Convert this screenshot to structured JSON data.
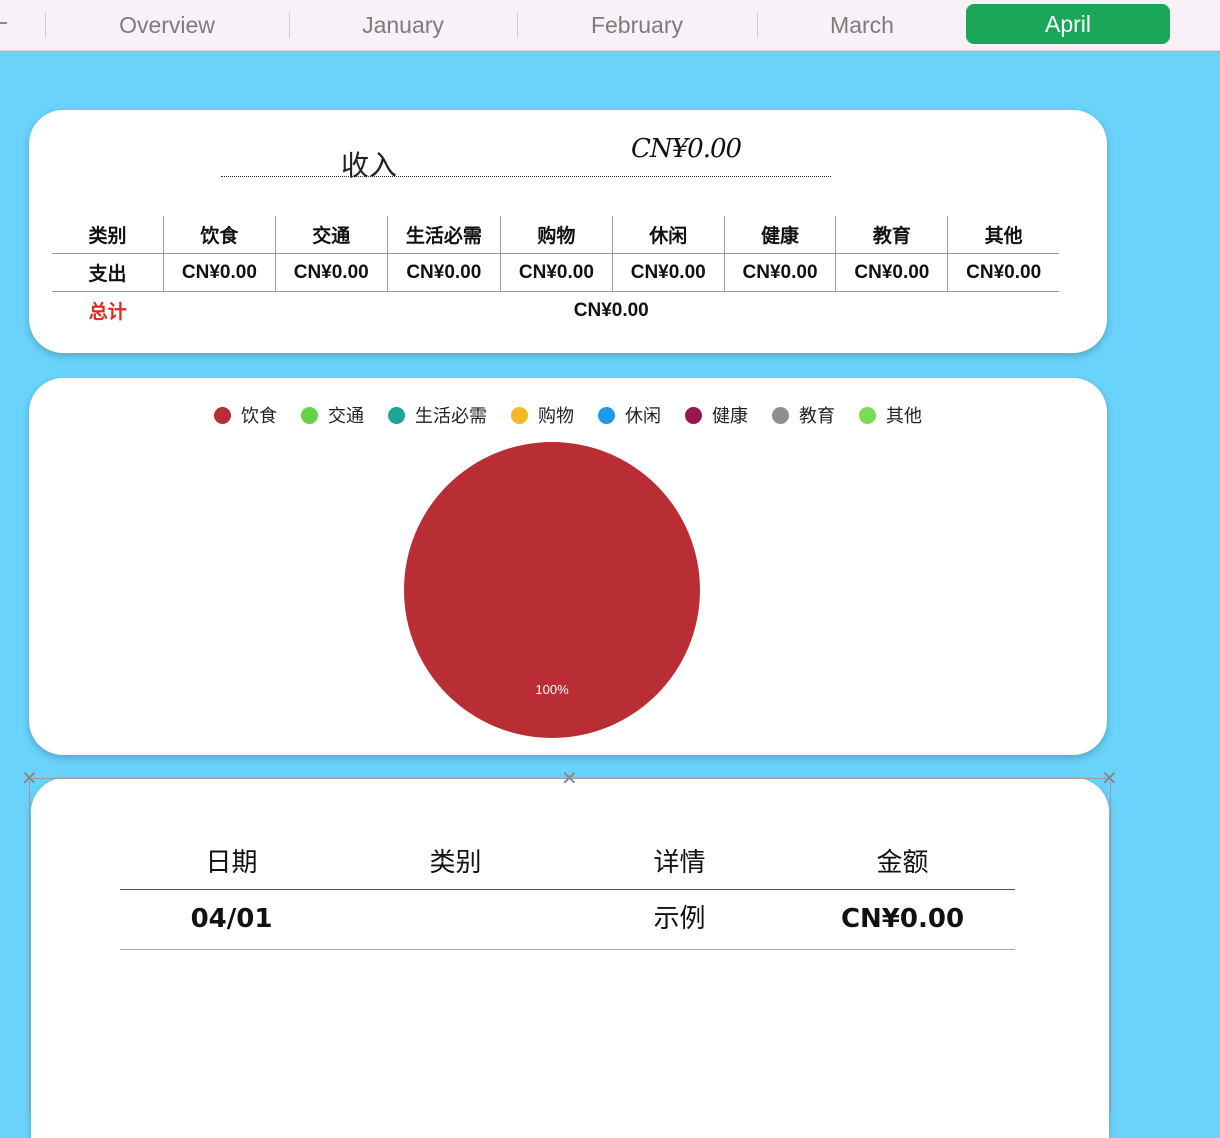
{
  "tabs": {
    "items": [
      "Overview",
      "January",
      "February",
      "March",
      "April"
    ],
    "active": "April"
  },
  "summary": {
    "income_label": "收入",
    "income_value": "CN¥0.00",
    "header": [
      "类别",
      "饮食",
      "交通",
      "生活必需",
      "购物",
      "休闲",
      "健康",
      "教育",
      "其他"
    ],
    "expense_label": "支出",
    "expense_values": [
      "CN¥0.00",
      "CN¥0.00",
      "CN¥0.00",
      "CN¥0.00",
      "CN¥0.00",
      "CN¥0.00",
      "CN¥0.00",
      "CN¥0.00"
    ],
    "total_label": "总计",
    "total_value": "CN¥0.00"
  },
  "chart_data": {
    "type": "pie",
    "legend": [
      {
        "name": "饮食",
        "color": "#b92d34"
      },
      {
        "name": "交通",
        "color": "#65d24a"
      },
      {
        "name": "生活必需",
        "color": "#1fa594"
      },
      {
        "name": "购物",
        "color": "#f7b825"
      },
      {
        "name": "休闲",
        "color": "#1a9bf0"
      },
      {
        "name": "健康",
        "color": "#96184f"
      },
      {
        "name": "教育",
        "color": "#8f8f8f"
      },
      {
        "name": "其他",
        "color": "#79dc57"
      }
    ],
    "slices": [
      {
        "name": "饮食",
        "value": 100,
        "label": "100%",
        "color": "#b92d34"
      }
    ]
  },
  "records": {
    "headers": [
      "日期",
      "类别",
      "详情",
      "金额"
    ],
    "rows": [
      {
        "date": "04/01",
        "category": "",
        "detail": "示例",
        "amount": "CN¥0.00"
      }
    ]
  }
}
